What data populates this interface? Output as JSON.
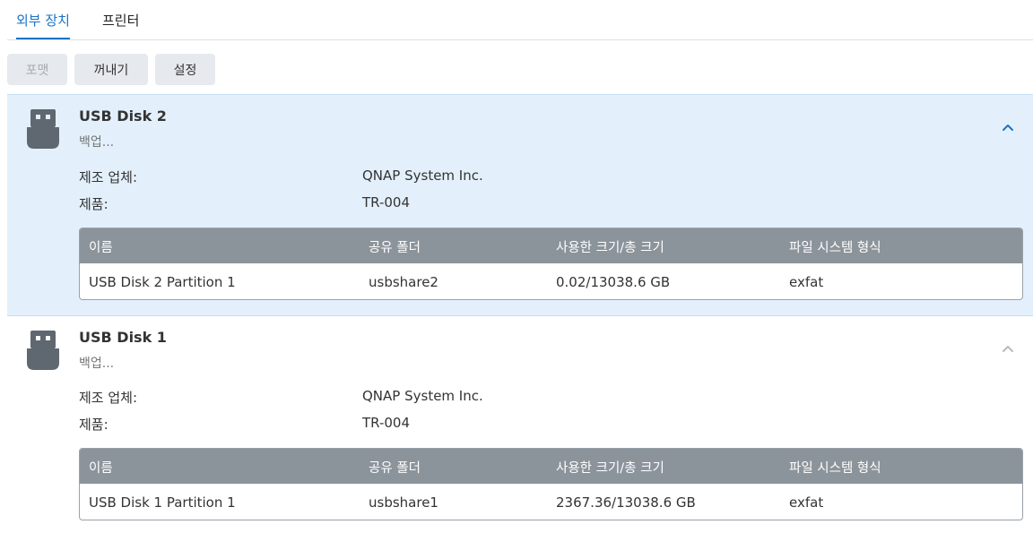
{
  "tabs": [
    {
      "label": "외부 장치",
      "active": true
    },
    {
      "label": "프린터",
      "active": false
    }
  ],
  "toolbar": {
    "format_label": "포맷",
    "eject_label": "꺼내기",
    "settings_label": "설정"
  },
  "table_headers": {
    "name": "이름",
    "shared_folder": "공유 폴더",
    "used_total": "사용한 크기/총 크기",
    "filesystem": "파일 시스템 형식"
  },
  "disks": [
    {
      "name": "USB Disk 2",
      "status": "백업...",
      "expanded": true,
      "manufacturer_label": "제조 업체:",
      "manufacturer": "QNAP System Inc.",
      "product_label": "제품:",
      "product": "TR-004",
      "partition": {
        "name": "USB Disk 2 Partition 1",
        "shared_folder": "usbshare2",
        "used_total": "0.02/13038.6 GB",
        "filesystem": "exfat"
      }
    },
    {
      "name": "USB Disk 1",
      "status": "백업...",
      "expanded": false,
      "manufacturer_label": "제조 업체:",
      "manufacturer": "QNAP System Inc.",
      "product_label": "제품:",
      "product": "TR-004",
      "partition": {
        "name": "USB Disk 1 Partition 1",
        "shared_folder": "usbshare1",
        "used_total": "2367.36/13038.6 GB",
        "filesystem": "exfat"
      }
    }
  ],
  "colors": {
    "accent": "#1a73c7",
    "selected_bg": "#e3f0fc",
    "table_header_bg": "#8c949b",
    "icon_gray": "#5f6870"
  },
  "icons": {
    "usb": "usb-drive-icon",
    "collapse": "chevron-up-icon"
  }
}
